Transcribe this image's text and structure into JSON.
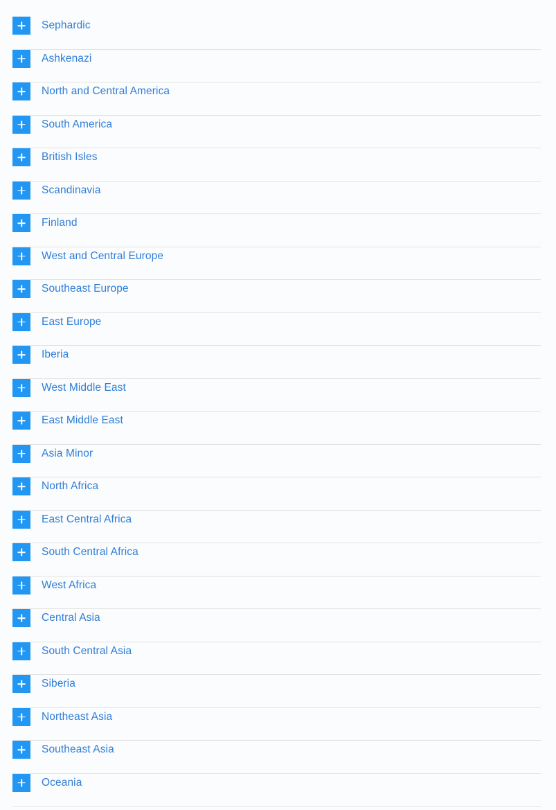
{
  "list": {
    "expand_icon": "plus-icon",
    "accent_color": "#2196f3",
    "label_color": "#2f7ed8",
    "separator_color": "#e2e2e2",
    "background_color": "#fbfcfd",
    "items": [
      {
        "label": "Sephardic"
      },
      {
        "label": "Ashkenazi"
      },
      {
        "label": "North and Central America"
      },
      {
        "label": "South America"
      },
      {
        "label": "British Isles"
      },
      {
        "label": "Scandinavia"
      },
      {
        "label": "Finland"
      },
      {
        "label": "West and Central Europe"
      },
      {
        "label": "Southeast Europe"
      },
      {
        "label": "East Europe"
      },
      {
        "label": "Iberia"
      },
      {
        "label": "West Middle East"
      },
      {
        "label": "East Middle East"
      },
      {
        "label": "Asia Minor"
      },
      {
        "label": "North Africa"
      },
      {
        "label": "East Central Africa"
      },
      {
        "label": "South Central Africa"
      },
      {
        "label": "West Africa"
      },
      {
        "label": "Central Asia"
      },
      {
        "label": "South Central Asia"
      },
      {
        "label": "Siberia"
      },
      {
        "label": "Northeast Asia"
      },
      {
        "label": "Southeast Asia"
      },
      {
        "label": "Oceania"
      }
    ]
  }
}
